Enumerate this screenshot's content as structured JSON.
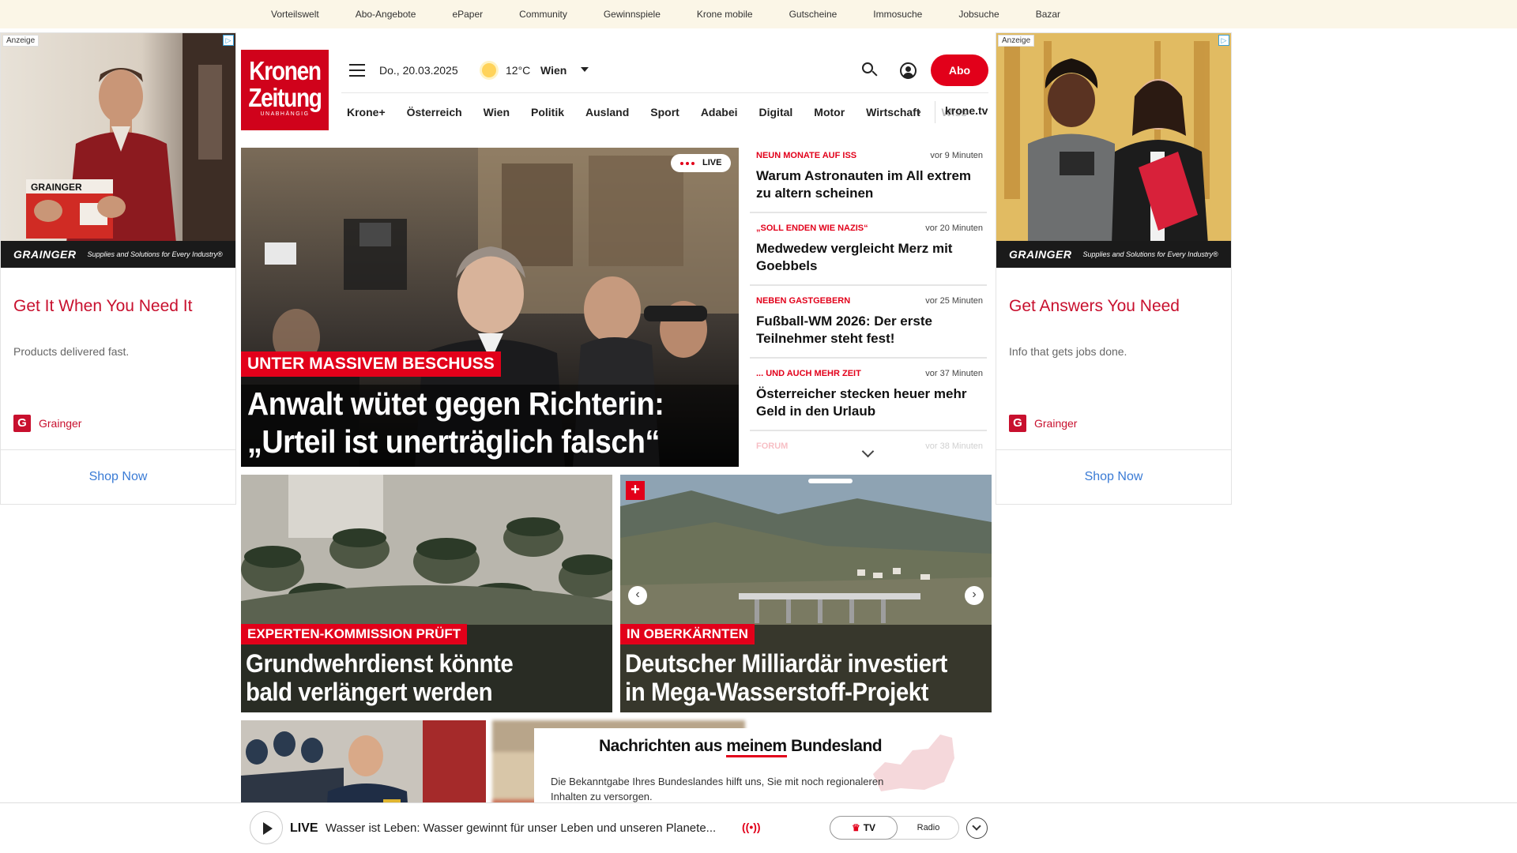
{
  "topbar": {
    "links": [
      "Vorteilswelt",
      "Abo-Angebote",
      "ePaper",
      "Community",
      "Gewinnspiele",
      "Krone mobile",
      "Gutscheine",
      "Immosuche",
      "Jobsuche",
      "Bazar"
    ]
  },
  "ads": {
    "left": {
      "tag": "Anzeige",
      "brand_strip": "GRAINGER",
      "strip_tagline": "Supplies and Solutions for Every Industry®",
      "title": "Get It When You Need It",
      "desc": "Products delivered fast.",
      "brand": "Grainger",
      "cta": "Shop Now"
    },
    "right": {
      "tag": "Anzeige",
      "brand_strip": "GRAINGER",
      "strip_tagline": "Supplies and Solutions for Every Industry®",
      "title": "Get Answers You Need",
      "desc": "Info that gets jobs done.",
      "brand": "Grainger",
      "cta": "Shop Now"
    }
  },
  "header": {
    "logo_line1": "Kronen",
    "logo_line2": "Zeitung",
    "logo_line3": "UNABHÄNGIG",
    "date": "Do., 20.03.2025",
    "temperature": "12°C",
    "city": "Wien",
    "abo_label": "Abo",
    "nav": [
      "Krone+",
      "Österreich",
      "Wien",
      "Politik",
      "Ausland",
      "Sport",
      "Adabei",
      "Digital",
      "Motor",
      "Wirtschaft",
      "Wiss"
    ],
    "krone_tv": "krone.tv"
  },
  "hero": {
    "live": "LIVE",
    "kicker": "UNTER MASSIVEM BESCHUSS",
    "headline_1": "Anwalt wütet gegen Richterin:",
    "headline_2": "„Urteil ist unerträglich falsch“"
  },
  "ticker": [
    {
      "category": "NEUN MONATE AUF ISS",
      "time": "vor 9 Minuten",
      "title": "Warum Astronauten im All extrem zu altern scheinen"
    },
    {
      "category": "„SOLL ENDEN WIE NAZIS“",
      "time": "vor 20 Minuten",
      "title": "Medwedew vergleicht Merz mit Goebbels"
    },
    {
      "category": "NEBEN GASTGEBERN",
      "time": "vor 25 Minuten",
      "title": "Fußball-WM 2026: Der erste Teilnehmer steht fest!"
    },
    {
      "category": "... UND AUCH MEHR ZEIT",
      "time": "vor 37 Minuten",
      "title": "Österreicher stecken heuer mehr Geld in den Urlaub"
    },
    {
      "category": "FORUM",
      "time": "vor 38 Minuten",
      "title": ""
    }
  ],
  "cards": [
    {
      "kicker": "EXPERTEN-KOMMISSION PRÜFT",
      "headline_1": "Grundwehrdienst könnte",
      "headline_2": "bald verlängert werden"
    },
    {
      "kicker": "IN OBERKÄRNTEN",
      "headline_1": "Deutscher Milliardär investiert",
      "headline_2": "in Mega-Wasserstoff-Projekt",
      "plus": "+"
    }
  ],
  "bundesland": {
    "title_prefix": "Nachrichten aus ",
    "title_highlight": "meinem",
    "title_suffix": " Bundesland",
    "text": "Die Bekanntgabe Ihres Bundeslandes hilft uns, Sie mit noch regionaleren Inhalten zu versorgen."
  },
  "player": {
    "live": "LIVE",
    "title": "Wasser ist Leben: Wasser gewinnt für unser Leben und unseren Planete...",
    "tv": "TV",
    "radio": "Radio"
  },
  "colors": {
    "accent": "#e2001a",
    "topbar_bg": "#fbf6e7",
    "ad_red": "#c8102e",
    "link_blue": "#3a7bd5"
  }
}
